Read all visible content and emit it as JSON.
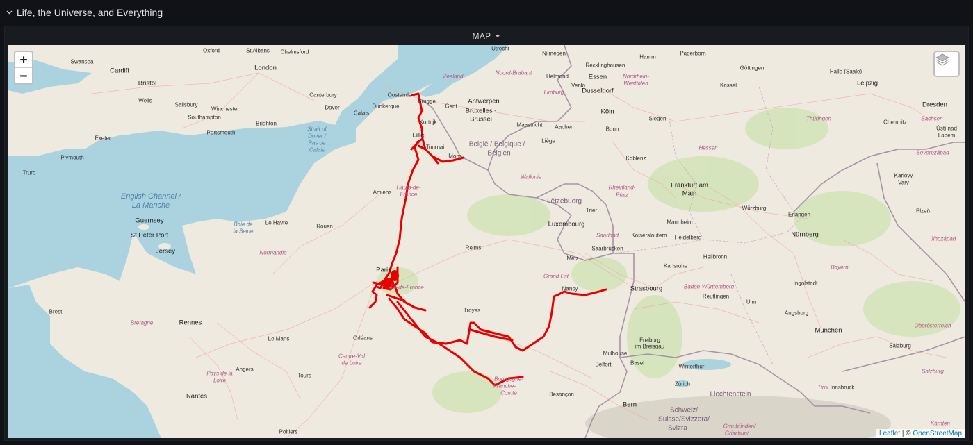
{
  "row": {
    "title": "Life, the Universe, and Everything",
    "chevron_icon": "chevron-down-icon"
  },
  "panel": {
    "title": "MAP"
  },
  "map": {
    "controls": {
      "zoom_in": "+",
      "zoom_out": "−",
      "layers_icon": "layers-icon"
    },
    "attribution": {
      "leaflet": "Leaflet",
      "separator": " | © ",
      "osm": "OpenStreetMap"
    },
    "colors": {
      "route": "#e80000",
      "sea": "#aad3df",
      "land": "#efeadf",
      "forest": "#c9dfb0",
      "boundary": "#a08aa3"
    },
    "labels": {
      "swansea": "Swansea",
      "cardiff": "Cardiff",
      "bristol": "Bristol",
      "wells": "Wells",
      "salisbury": "Salisbury",
      "winchester": "Winchester",
      "southampton": "Southampton",
      "portsmouth": "Portsmouth",
      "brighton": "Brighton",
      "exeter": "Exeter",
      "plymouth": "Plymouth",
      "truro": "Truro",
      "oxford": "Oxford",
      "st_albans": "St Albans",
      "chelmsford": "Chelmsford",
      "london": "London",
      "canterbury": "Canterbury",
      "dover": "Dover",
      "english_channel": "English Channel /",
      "la_manche": "La Manche",
      "strait": "Strait of",
      "dover_it": "Dover /",
      "pas_de": "Pas de",
      "calais_it": "Calais",
      "guernsey": "Guernsey",
      "st_peter_port": "St Peter Port",
      "jersey": "Jersey",
      "brest": "Brest",
      "bretagne": "Bretagne",
      "rennes": "Rennes",
      "nantes": "Nantes",
      "angers": "Angers",
      "tours": "Tours",
      "le_mans": "Le Mans",
      "orleans": "Orléans",
      "poitiers": "Poitiers",
      "pays_loire": "Pays de la",
      "pays_loire2": "Loire",
      "centre": "Centre-Val",
      "centre2": "de Loire",
      "normandie": "Normandie",
      "baie_seine": "Baie de",
      "baie_seine2": "la Seine",
      "le_havre": "Le Havre",
      "rouen": "Rouen",
      "amiens": "Amiens",
      "hauts": "Hauts-de-",
      "hauts2": "France",
      "calais": "Calais",
      "dunkerque": "Dunkerque",
      "oostende": "Oostende",
      "brugge": "Brugge",
      "gent": "Gent",
      "kortrijk": "Kortrijk",
      "lille": "Lille",
      "tournai": "Tournai",
      "mons": "Mons",
      "antwerpen": "Antwerpen",
      "bruxelles": "Bruxelles -",
      "brussel": "Brussel",
      "belgie": "België / Belgique /",
      "belgien": "Belgien",
      "wallonie": "Wallonie",
      "maastricht": "Maastricht",
      "liege": "Liège",
      "aachen": "Aachen",
      "zeeland": "Zeeland",
      "noord_brabant": "Noord-Brabant",
      "limburg": "Limburg",
      "utrecht": "Utrecht",
      "nijmegen": "Nijmegen",
      "helmond": "Helmond",
      "venlo": "Venlo",
      "essen": "Essen",
      "dusseldorf": "Dusseldorf",
      "nrw": "Nordrhein-",
      "nrw2": "Westfalen",
      "koln": "Köln",
      "bonn": "Bonn",
      "siegen": "Siegen",
      "recklinghausen": "Recklinghausen",
      "hamm": "Hamm",
      "paderborn": "Paderborn",
      "gottingen": "Göttingen",
      "kassel": "Kassel",
      "halle": "Halle (Saale)",
      "leipzig": "Leipzig",
      "dresden": "Dresden",
      "chemnitz": "Chemnitz",
      "sachsen": "Sachsen",
      "thuringen": "Thüringen",
      "hessen": "Hessen",
      "usti": "Ústí nad",
      "labem": "Labem",
      "severozapad": "Severozápad",
      "karlovy": "Karlovy",
      "vary": "Vary",
      "plzen": "Plzeň",
      "jihozapad": "Jihozápad",
      "koblenz": "Koblenz",
      "frankfurt": "Frankfurt am",
      "main": "Main",
      "rheinland": "Rheinland-",
      "pfalz": "Pfalz",
      "letzebuerg": "Lëtzebuerg",
      "trier": "Trier",
      "luxembourg": "Luxembourg",
      "saarland": "Saarland",
      "saarbrucken": "Saarbrücken",
      "kaiserslautern": "Kaiserslautern",
      "mannheim": "Mannheim",
      "heidelberg": "Heidelberg",
      "wurzburg": "Würzburg",
      "erlangen": "Erlangen",
      "nurnberg": "Nürnberg",
      "heilbronn": "Heilbronn",
      "karlsruhe": "Karlsruhe",
      "ingolstadt": "Ingolstadt",
      "bayern": "Bayern",
      "bw": "Baden-Württemberg",
      "reutlingen": "Reutlingen",
      "ulm": "Ulm",
      "augsburg": "Augsburg",
      "munchen": "München",
      "oberosterreich": "Oberösterreich",
      "salzburg": "Salzburg",
      "tirol": "Tirol",
      "innsbruck": "Innsbruck",
      "karnten": "Kärnten",
      "reims": "Reims",
      "metz": "Metz",
      "nancy": "Nancy",
      "grand_est": "Grand Est",
      "strasbourg": "Strasbourg",
      "troyes": "Troyes",
      "paris": "Paris",
      "ile": "Île-de-France",
      "freiburg": "Freiburg",
      "im_breisgau": "im Breisgau",
      "mulhouse": "Mulhouse",
      "basel": "Basel",
      "belfort": "Belfort",
      "besancon": "Besançon",
      "bourgogne": "Bourgogne-",
      "franche": "Franche-",
      "comte": "Comté",
      "winterthur": "Winterthur",
      "zurich": "Zürich",
      "liechtenstein": "Liechtenstein",
      "bern": "Bern",
      "schweiz": "Schweiz/",
      "suisse": "Suisse/Svizzera/",
      "svizra": "Svizra",
      "graubunden": "Graubünden/",
      "grischun": "Grischun/"
    }
  }
}
